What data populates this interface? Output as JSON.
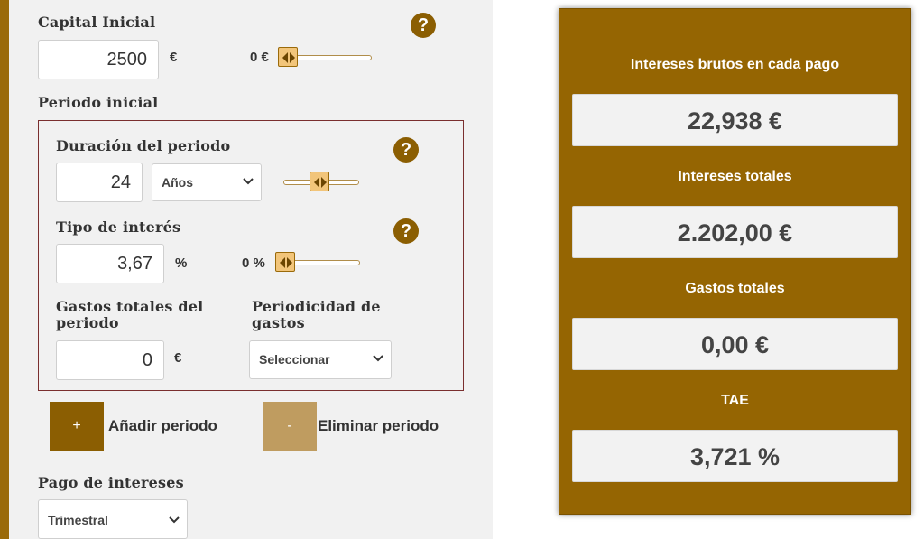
{
  "capital": {
    "label": "Capital Inicial",
    "value": "2500",
    "unit": "€",
    "slider_label": "0 €",
    "slider_level": 0
  },
  "periodo": {
    "label": "Periodo inicial",
    "duracion": {
      "label": "Duración del periodo",
      "value": "24",
      "unit_select": "Años",
      "slider_level": 0.45
    },
    "interes": {
      "label": "Tipo de interés",
      "value": "3,67",
      "unit": "%",
      "slider_label": "0 %",
      "slider_level": 0
    },
    "gastos": {
      "label_line1": "Gastos totales del",
      "label_line2": "periodo",
      "value": "0",
      "unit": "€"
    },
    "periodicidad": {
      "label_line1": "Periodicidad de",
      "label_line2": "gastos",
      "select": "Seleccionar"
    }
  },
  "buttons": {
    "add_symbol": "+",
    "add_label": "Añadir periodo",
    "remove_symbol": "-",
    "remove_label": "Eliminar periodo"
  },
  "pago": {
    "label": "Pago de intereses",
    "select": "Trimestral"
  },
  "help_symbol": "?",
  "results": [
    {
      "label": "Intereses brutos en cada pago",
      "value": "22,938 €"
    },
    {
      "label": "Intereses totales",
      "value": "2.202,00 €"
    },
    {
      "label": "Gastos totales",
      "value": "0,00 €"
    },
    {
      "label": "TAE",
      "value": "3,721 %"
    }
  ],
  "colors": {
    "brand": "#956502",
    "add_button": "#8b5e02",
    "remove_button": "#bf9c60",
    "period_border": "#7a2f2f"
  }
}
